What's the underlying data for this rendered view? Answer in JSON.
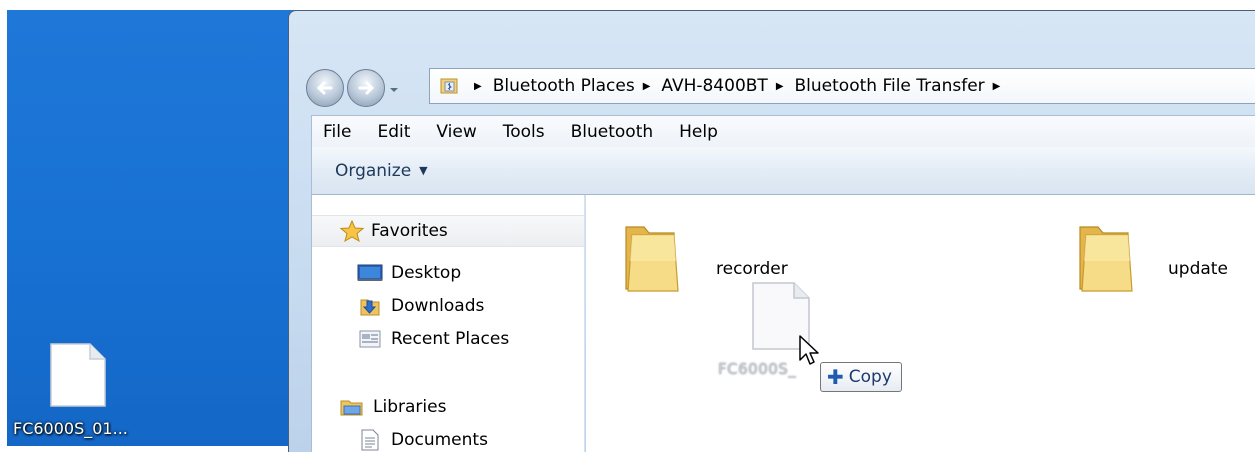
{
  "desktop": {
    "icon_label": "FC6000S_01...",
    "icon_name": "document-icon",
    "background_color": "#1d74d6"
  },
  "window": {
    "nav": {
      "back_icon": "back-arrow-icon",
      "forward_icon": "forward-arrow-icon",
      "history_icon": "chevron-down-icon"
    },
    "address": {
      "icon": "bluetooth-places-icon",
      "crumbs": [
        "Bluetooth Places",
        "AVH-8400BT",
        "Bluetooth File Transfer"
      ]
    },
    "menu": [
      "File",
      "Edit",
      "View",
      "Tools",
      "Bluetooth",
      "Help"
    ],
    "toolbar": {
      "organize_label": "Organize"
    },
    "nav_pane": {
      "favorites_label": "Favorites",
      "favorites": [
        {
          "label": "Desktop",
          "icon": "desktop-icon"
        },
        {
          "label": "Downloads",
          "icon": "downloads-icon"
        },
        {
          "label": "Recent Places",
          "icon": "recent-places-icon"
        }
      ],
      "libraries_label": "Libraries",
      "libraries": [
        {
          "label": "Documents",
          "icon": "documents-icon"
        }
      ]
    },
    "content": {
      "folders": [
        {
          "name": "recorder",
          "icon": "folder-icon"
        },
        {
          "name": "update",
          "icon": "folder-icon"
        }
      ],
      "drag": {
        "file_name": "FC6000S_",
        "tooltip_label": "Copy",
        "tooltip_icon": "plus-icon"
      }
    }
  },
  "colors": {
    "accent": "#1f5cb0",
    "folder": "#f1cf6b",
    "window_frame": "#c7dbf0"
  }
}
